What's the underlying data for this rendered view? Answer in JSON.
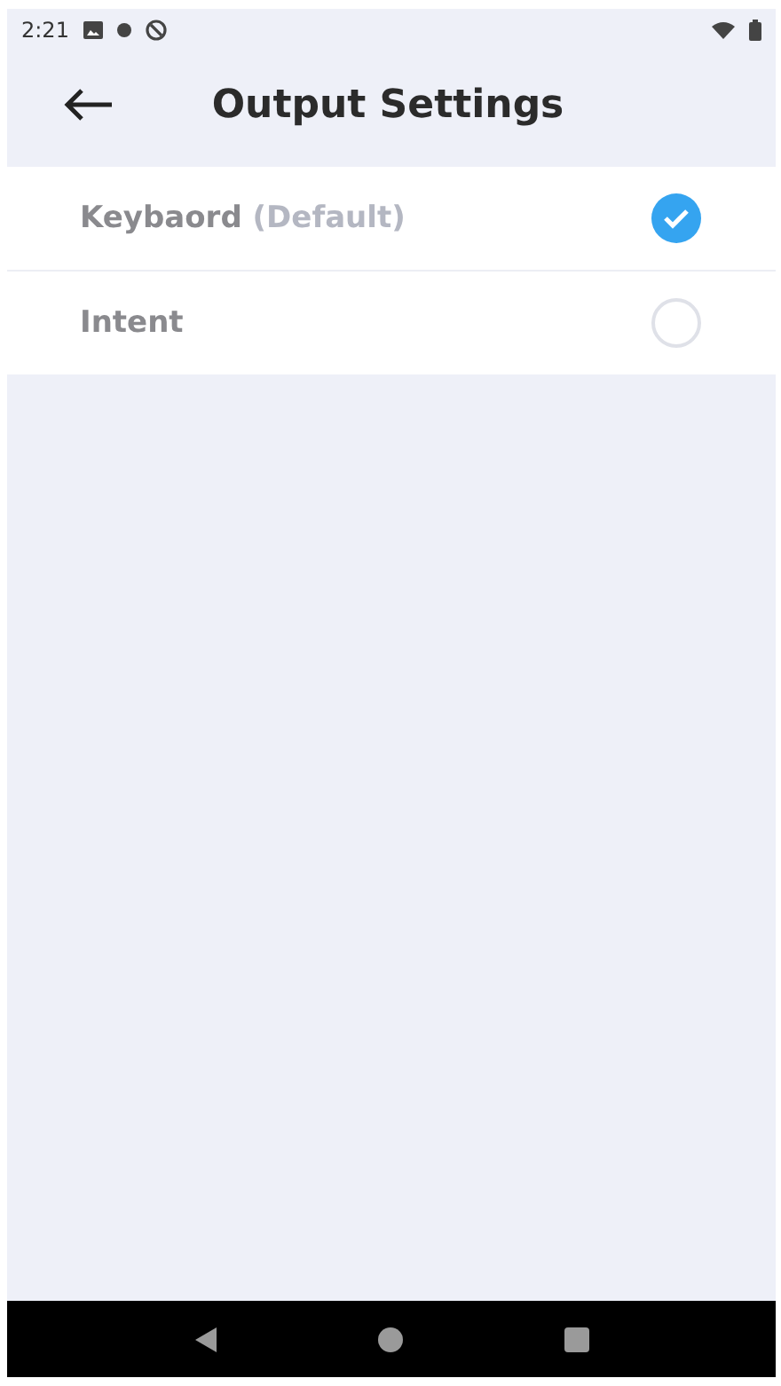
{
  "status_bar": {
    "time": "2:21"
  },
  "header": {
    "title": "Output Settings"
  },
  "options": [
    {
      "label": "Keybaord",
      "note": "(Default)",
      "selected": true
    },
    {
      "label": "Intent",
      "selected": false
    }
  ]
}
